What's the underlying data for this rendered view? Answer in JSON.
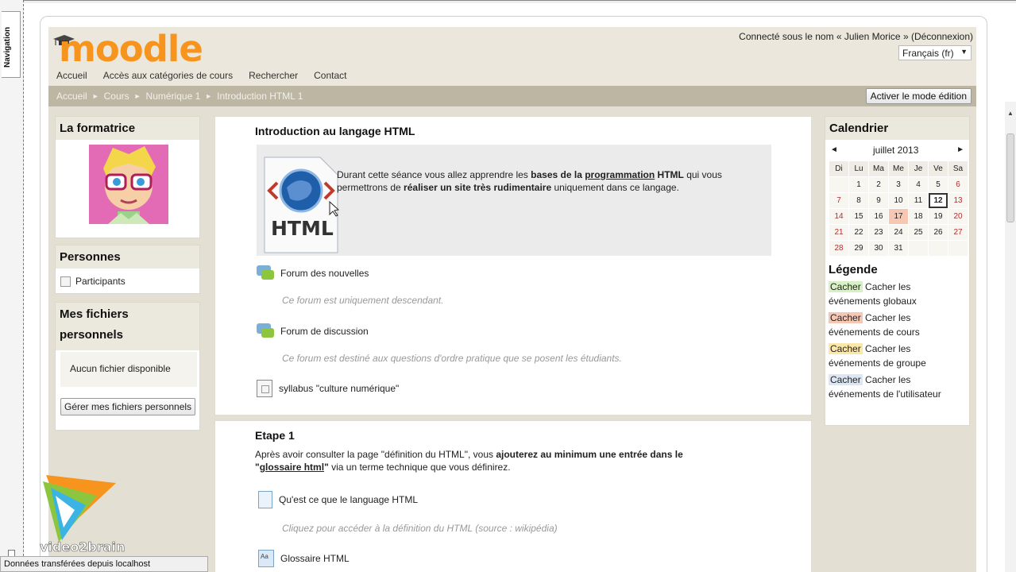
{
  "side_nav": {
    "label": "Navigation"
  },
  "header": {
    "logo_text": "moodle",
    "login_info": "Connecté sous le nom « Julien Morice » (Déconnexion)",
    "language": "Français (fr)",
    "menu": [
      "Accueil",
      "Accès aux catégories de cours",
      "Rechercher",
      "Contact"
    ]
  },
  "breadcrumb": {
    "items": [
      "Accueil",
      "Cours",
      "Numérique 1",
      "Introduction HTML 1"
    ],
    "separator": "►",
    "edit_button": "Activer le mode édition"
  },
  "left": {
    "trainer_title": "La formatrice",
    "people_title": "Personnes",
    "participants": "Participants",
    "files_title_1": "Mes fichiers",
    "files_title_2": "personnels",
    "no_files": "Aucun fichier disponible",
    "manage_files_button": "Gérer mes fichiers personnels"
  },
  "main": {
    "section0_title": "Introduction au langage HTML",
    "html_icon_label": "HTML",
    "intro_line1_a": "Durant cette séance vous allez apprendre les ",
    "intro_line1_b": "bases de la ",
    "intro_line1_link": "programmation",
    "intro_line1_c": " HTML",
    "intro_line1_d": " qui vous",
    "intro_line2_a": "permettrons de ",
    "intro_line2_b": "réaliser un site très rudimentaire",
    "intro_line2_c": " uniquement dans ce langage.",
    "forum_news": "Forum des nouvelles",
    "forum_news_desc": "Ce forum est uniquement descendant.",
    "forum_discussion": "Forum de discussion",
    "forum_discussion_desc": "Ce forum est destiné aux questions d'ordre pratique que se posent les étudiants.",
    "syllabus": "syllabus \"culture numérique\"",
    "section1_title": "Etape 1",
    "step_line1_a": "Après avoir consulter la page \"définition du HTML\", vous ",
    "step_line1_b": "ajouterez au minimum une entrée dans le",
    "step_line2_a": "\"",
    "step_line2_link": "glossaire html",
    "step_line2_b": "\"",
    "step_line2_c": " via un terme technique que vous définirez.",
    "page_html": "Qu'est ce que le language HTML",
    "page_html_desc": "Cliquez pour accéder à la définition du HTML (source : wikipédia)",
    "glossary": "Glossaire HTML"
  },
  "calendar": {
    "title": "Calendrier",
    "month": "juillet 2013",
    "prev": "◄",
    "next": "►",
    "days": [
      "Di",
      "Lu",
      "Ma",
      "Me",
      "Je",
      "Ve",
      "Sa"
    ],
    "weeks": [
      [
        "",
        "1",
        "2",
        "3",
        "4",
        "5",
        "6"
      ],
      [
        "7",
        "8",
        "9",
        "10",
        "11",
        "12",
        "13"
      ],
      [
        "14",
        "15",
        "16",
        "17",
        "18",
        "19",
        "20"
      ],
      [
        "21",
        "22",
        "23",
        "24",
        "25",
        "26",
        "27"
      ],
      [
        "28",
        "29",
        "30",
        "31",
        "",
        "",
        ""
      ]
    ],
    "today": "12",
    "event_day": "17",
    "legend_title": "Légende",
    "legend": [
      {
        "tag": "Cacher",
        "line1": " Cacher les",
        "line2": "événements globaux",
        "color": "#d7f0c4"
      },
      {
        "tag": "Cacher",
        "line1": " Cacher les",
        "line2": "événements de cours",
        "color": "#f6c8b4"
      },
      {
        "tag": "Cacher",
        "line1": " Cacher les",
        "line2": "événements de groupe",
        "color": "#fbe7a8"
      },
      {
        "tag": "Cacher",
        "line1": " Cacher les",
        "line2": "événements de l'utilisateur",
        "color": "#dde6f3"
      }
    ]
  },
  "watermark": "video2brain",
  "status_bar": "Données transférées depuis localhost",
  "colors": {
    "moodle_orange": "#f7941d",
    "breadcrumb_bar": "#bcb6a3",
    "page_bg": "#e3dfd2"
  }
}
